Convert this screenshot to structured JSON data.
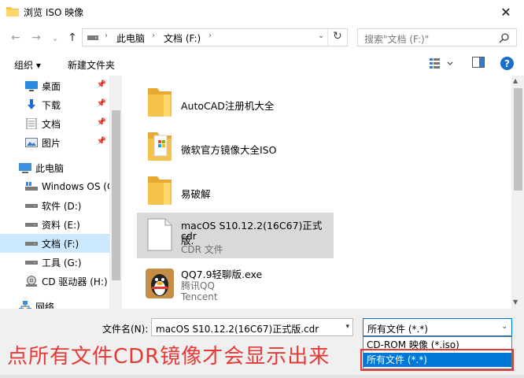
{
  "window": {
    "title": "浏览 ISO 映像",
    "close_glyph": "✕"
  },
  "nav_buttons": {
    "back": "←",
    "forward": "→",
    "recent": "⌄",
    "up": "↑"
  },
  "address": {
    "segments": [
      "此电脑",
      "文档 (F:)"
    ],
    "separator": "›",
    "dropdown": "⌄",
    "refresh": "↻"
  },
  "search": {
    "placeholder": "搜索\"文档 (F:)\"",
    "icon": "search-icon"
  },
  "toolbar": {
    "organize": "组织 ▾",
    "new_folder": "新建文件夹",
    "help": "?"
  },
  "nav_pane": [
    {
      "label": "桌面",
      "icon": "desktop-icon",
      "pinned": true
    },
    {
      "label": "下载",
      "icon": "download-icon",
      "pinned": true
    },
    {
      "label": "文档",
      "icon": "documents-icon",
      "pinned": true
    },
    {
      "label": "图片",
      "icon": "pictures-icon",
      "pinned": true
    },
    {
      "label": "此电脑",
      "icon": "computer-icon",
      "pinned": false
    },
    {
      "label": "Windows OS (C",
      "icon": "os-drive-icon",
      "pinned": false
    },
    {
      "label": "软件 (D:)",
      "icon": "drive-icon",
      "pinned": false
    },
    {
      "label": "资料 (E:)",
      "icon": "drive-icon",
      "pinned": false
    },
    {
      "label": "文档 (F:)",
      "icon": "drive-icon",
      "pinned": false,
      "selected": true
    },
    {
      "label": "工具 (G:)",
      "icon": "drive-icon",
      "pinned": false
    },
    {
      "label": "CD 驱动器 (H:)",
      "icon": "cd-drive-icon",
      "pinned": false
    },
    {
      "label": "网络",
      "icon": "network-icon",
      "pinned": false
    }
  ],
  "files": [
    {
      "name": "AutoCAD注册机大全",
      "type": "folder"
    },
    {
      "name": "微软官方镜像大全ISO",
      "type": "folder"
    },
    {
      "name": "易破解",
      "type": "folder"
    },
    {
      "name_line1": "macOS S10.12.2(16C67)正式版.",
      "name_line2": "cdr",
      "sub": "CDR 文件",
      "type": "file",
      "selected": true
    },
    {
      "name": "QQ7.9轻聊版.exe",
      "sub1": "腾讯QQ",
      "sub2": "Tencent",
      "type": "exe"
    }
  ],
  "bottom": {
    "filename_label": "文件名(N):",
    "filename_value": "macOS S10.12.2(16C67)正式版.cdr",
    "filetype_value": "所有文件 (*.*)",
    "options": [
      "CD-ROM 映像 (*.iso)",
      "所有文件 (*.*)"
    ],
    "annotation": "点所有文件CDR镜像才会显示出来"
  },
  "colors": {
    "accent": "#0078d7",
    "annotation": "#e53935",
    "selection": "#cce8ff",
    "folder": "#f5c24b"
  }
}
